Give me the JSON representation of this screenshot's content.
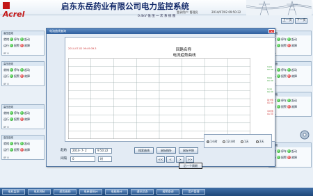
{
  "header": {
    "logo_text": "Acrel",
    "title": "启东东岳药业有限公司电力监控系统",
    "subtitle": "0.4kV 低 压 一 次 系 统 图",
    "login": "登录用户: 管理员",
    "datetime": "2014/07/02 09:50:22"
  },
  "paging": {
    "prev": "上一页",
    "next": "下一页"
  },
  "panels_left": [
    {
      "name": "高压进线",
      "row1_a": "就绪",
      "row1_b": "停车",
      "row1_c": "起动",
      "row2_a": "运行",
      "row2_b": "报警",
      "row2_c": "故障",
      "footer": "0F 0"
    },
    {
      "name": "高压进线",
      "row1_a": "就绪",
      "row1_b": "停车",
      "row1_c": "起动",
      "row2_a": "运行",
      "row2_b": "报警",
      "row2_c": "故障",
      "footer": "0F 0"
    },
    {
      "name": "高压进线",
      "row1_a": "就绪",
      "row1_b": "停车",
      "row1_c": "起动",
      "row2_a": "运行",
      "row2_b": "报警",
      "row2_c": "故障",
      "footer": "0F 0"
    },
    {
      "name": "高压进线",
      "row1_a": "就绪",
      "row1_b": "停车",
      "row1_c": "起动",
      "row2_a": "运行",
      "row2_b": "报警",
      "row2_c": "故障",
      "footer": "0F 0"
    }
  ],
  "panels_right": [
    {
      "name": "出线柜",
      "row1_a": "就绪",
      "row1_b": "停车",
      "row1_c": "起动",
      "row2_a": "运行",
      "row2_b": "报警",
      "row2_c": "故障",
      "footer": "0F 0"
    },
    {
      "name": "出线柜",
      "row1_a": "就绪",
      "row1_b": "停车",
      "row1_c": "起动",
      "row2_a": "运行",
      "row2_b": "报警",
      "row2_c": "故障",
      "footer": "0F 0"
    },
    {
      "name": "出线柜",
      "row1_a": "就绪",
      "row1_b": "停车",
      "row1_c": "起动",
      "row2_a": "运行",
      "row2_b": "报警",
      "row2_c": "故障",
      "footer": "0F 0"
    },
    {
      "name": "出线柜",
      "row1_a": "就绪",
      "row1_b": "停车",
      "row1_c": "起动",
      "row2_a": "运行",
      "row2_b": "报警",
      "row2_c": "故障",
      "footer": "0F 0"
    }
  ],
  "dialog": {
    "title": "电流曲线查询",
    "close": "×",
    "chart_title": "回路名称",
    "chart_subtitle": "电流趋势曲线",
    "chart_time": "2014-07-02 09:49:39.3",
    "readouts": [
      {
        "label": "Ia(A)",
        "value": "0A 00",
        "color": "#2a9a2a"
      },
      {
        "label": "Ib(A)",
        "value": "0A 00",
        "color": "#2a9a2a"
      },
      {
        "label": "Ic(A)",
        "value": "0A 00",
        "color": "#2a9a2a"
      },
      {
        "label": "最大值",
        "value": "0A 00",
        "color": "#c33"
      },
      {
        "label": "平均值",
        "value": "0A 00",
        "color": "#c33"
      }
    ],
    "start_label": "起始",
    "start_date": "2014- 7- 2",
    "start_time": "9:50:22",
    "interval_label": "间隔",
    "interval_value": "0",
    "interval_unit": "时",
    "buttons": {
      "query": "搜索曲线",
      "tip": "鼠标指针",
      "sample": "鼠标平移",
      "first": "<<",
      "prev": "<",
      "next": ">",
      "last": ">>",
      "next_cycle": "后一个周期"
    },
    "radios": [
      {
        "label": "1小时",
        "checked": true
      },
      {
        "label": "12小时",
        "checked": false
      },
      {
        "label": "1天",
        "checked": false
      },
      {
        "label": "2天",
        "checked": false
      }
    ]
  },
  "chart_data": {
    "type": "line",
    "title": "回路名称",
    "subtitle": "电流趋势曲线",
    "x": [],
    "series": [],
    "grid": true,
    "grid_columns": 8,
    "grid_rows": 10
  },
  "bottom_nav": [
    "电机监测",
    "电机控制",
    "趋势曲线",
    "电参量统计",
    "电能统计",
    "通讯状态",
    "报警查询",
    "用户管理"
  ],
  "colors": {
    "title": "#132a6a",
    "logo": "#c31818",
    "nav": "#2e5b92"
  }
}
